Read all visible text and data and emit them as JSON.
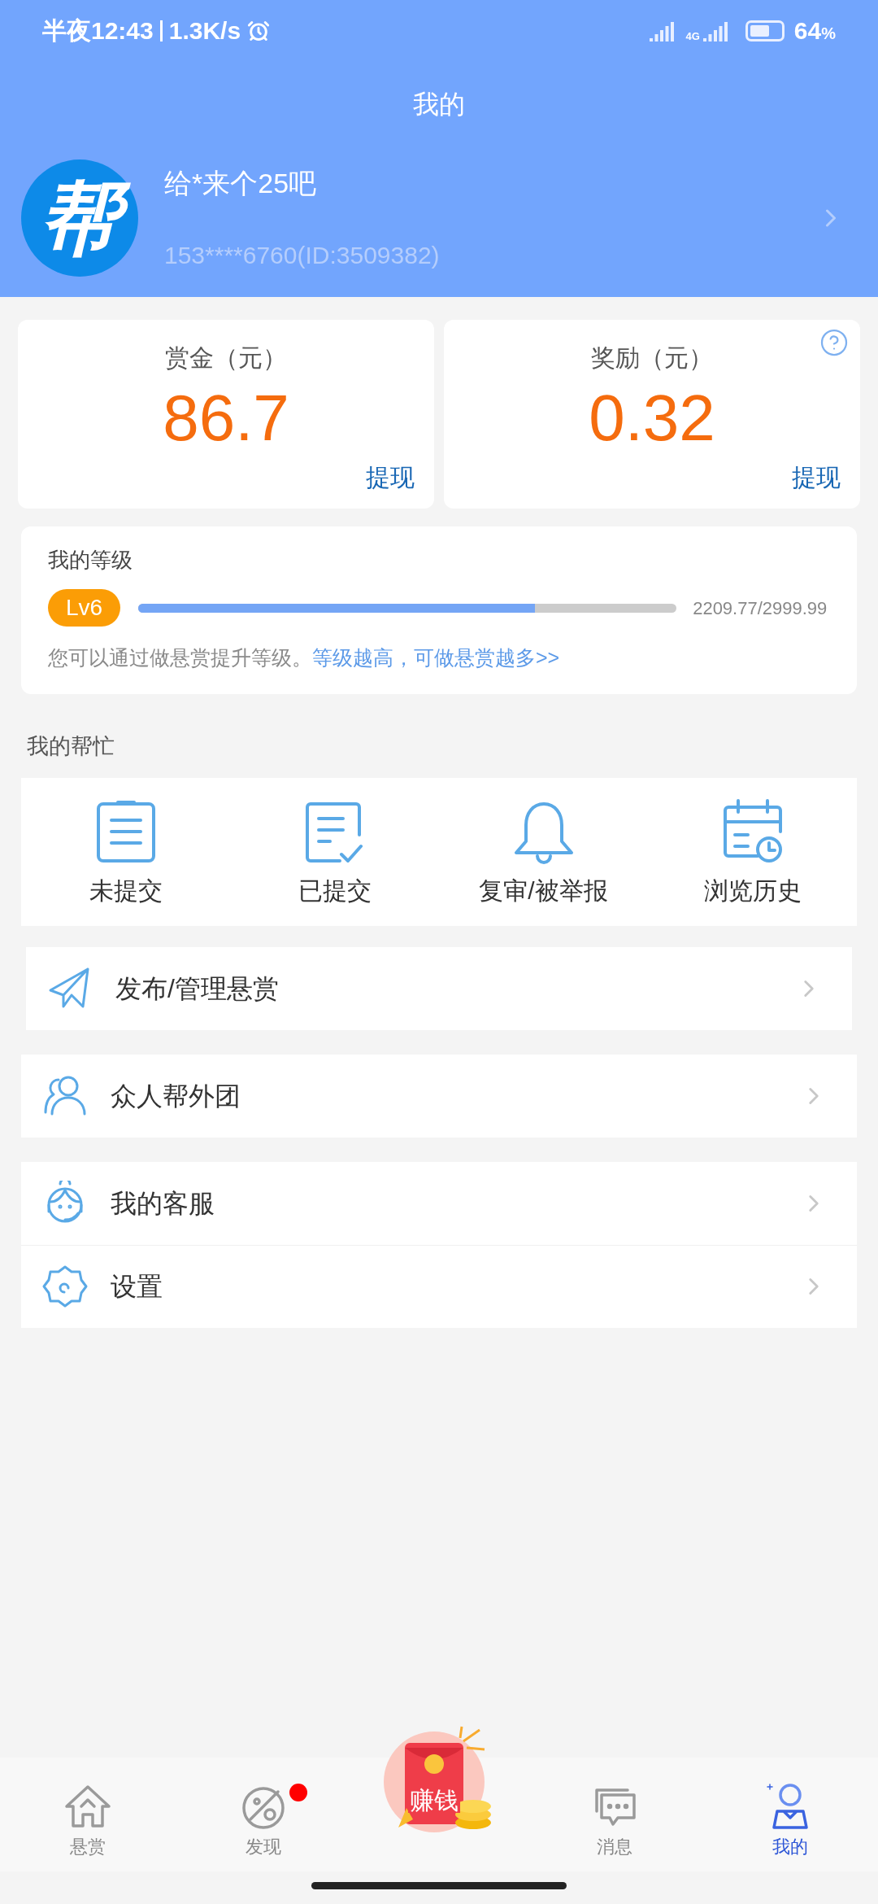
{
  "status_bar": {
    "time": "半夜12:43",
    "speed": "1.3K/s",
    "battery": "64",
    "battery_unit": "%",
    "network": "4G"
  },
  "header": {
    "title": "我的"
  },
  "profile": {
    "name": "给*来个25吧",
    "account": "153****6760(ID:3509382)",
    "logo_text": "帮"
  },
  "balances": [
    {
      "label": "赏金（元）",
      "amount": "86.7",
      "action": "提现",
      "help": false
    },
    {
      "label": "奖励（元）",
      "amount": "0.32",
      "action": "提现",
      "help": true
    }
  ],
  "level": {
    "title": "我的等级",
    "badge": "Lv6",
    "level": 0.7366,
    "reading": "2209.77/2999.99",
    "hint": "您可以通过做悬赏提升等级。",
    "link": "等级越高，可做悬赏越多>>"
  },
  "help_section": {
    "title": "我的帮忙",
    "items": [
      {
        "kind": "clipboard",
        "label": "未提交"
      },
      {
        "kind": "checked",
        "label": "已提交"
      },
      {
        "kind": "bell",
        "label": "复审/被举报"
      },
      {
        "kind": "calendar",
        "label": "浏览历史"
      }
    ]
  },
  "menu_groups": [
    [
      {
        "kind": "send",
        "label": "发布/管理悬赏"
      }
    ],
    [
      {
        "kind": "people",
        "label": "众人帮外团"
      }
    ],
    [
      {
        "kind": "service",
        "label": "我的客服"
      },
      {
        "kind": "settings",
        "label": "设置"
      }
    ]
  ],
  "tab_bar": [
    {
      "kind": "home",
      "label": "悬赏",
      "selected": false,
      "dot": false
    },
    {
      "kind": "discover",
      "label": "发现",
      "selected": false,
      "dot": true
    },
    {
      "kind": "redpacket",
      "label": "赚钱",
      "selected": false,
      "dot": false
    },
    {
      "kind": "messages",
      "label": "消息",
      "selected": false,
      "dot": false
    },
    {
      "kind": "me",
      "label": "我的",
      "selected": true,
      "dot": false
    }
  ]
}
